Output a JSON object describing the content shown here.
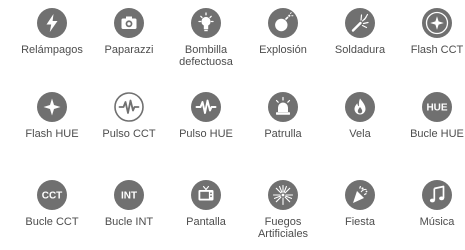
{
  "effects": [
    [
      {
        "icon": "lightning-icon",
        "label": "Relámpagos"
      },
      {
        "icon": "camera-icon",
        "label": "Paparazzi"
      },
      {
        "icon": "lightbulb-icon",
        "label": "Bombilla\ndefectuosa"
      },
      {
        "icon": "bomb-icon",
        "label": "Explosión"
      },
      {
        "icon": "welding-sparks-icon",
        "label": "Soldadura"
      },
      {
        "icon": "flash-star-icon",
        "label": "Flash CCT"
      }
    ],
    [
      {
        "icon": "flash-star-icon",
        "label": "Flash HUE"
      },
      {
        "icon": "pulse-wave-icon",
        "label": "Pulso CCT"
      },
      {
        "icon": "pulse-wave-icon",
        "label": "Pulso HUE"
      },
      {
        "icon": "police-siren-icon",
        "label": "Patrulla"
      },
      {
        "icon": "candle-flame-icon",
        "label": "Vela"
      },
      {
        "icon": "hue-badge-icon",
        "label": "Bucle HUE",
        "badge": "HUE"
      }
    ],
    [
      {
        "icon": "cct-badge-icon",
        "label": "Bucle CCT",
        "badge": "CCT"
      },
      {
        "icon": "int-badge-icon",
        "label": "Bucle INT",
        "badge": "INT"
      },
      {
        "icon": "tv-screen-icon",
        "label": "Pantalla"
      },
      {
        "icon": "fireworks-icon",
        "label": "Fuegos\nArtificiales"
      },
      {
        "icon": "party-popper-icon",
        "label": "Fiesta"
      },
      {
        "icon": "music-note-icon",
        "label": "Música"
      }
    ]
  ],
  "colors": {
    "icon_fill": "#707070",
    "icon_glyph": "#ffffff",
    "label": "#4d4d4d"
  }
}
